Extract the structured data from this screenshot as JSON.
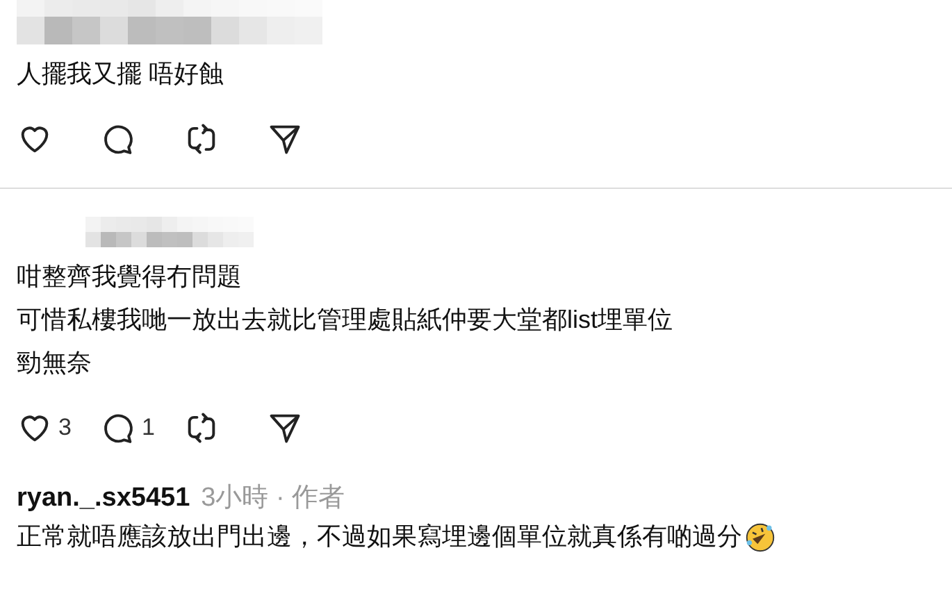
{
  "posts": [
    {
      "header": {
        "kind": "pixelated"
      },
      "lines": [
        "人擺我又擺 唔好蝕"
      ],
      "actions": [
        {
          "kind": "like"
        },
        {
          "kind": "reply"
        },
        {
          "kind": "repost"
        },
        {
          "kind": "share"
        }
      ]
    },
    {
      "header": {
        "kind": "pixelated"
      },
      "lines": [
        "咁整齊我覺得冇問題",
        "可惜私樓我哋一放出去就比管理處貼紙仲要大堂都list埋單位",
        "勁無奈"
      ],
      "actions": [
        {
          "kind": "like",
          "count": "3"
        },
        {
          "kind": "reply",
          "count": "1"
        },
        {
          "kind": "repost"
        },
        {
          "kind": "share"
        }
      ]
    },
    {
      "header": {
        "kind": "user",
        "username": "ryan._.sx5451",
        "meta": "3小時 · 作者"
      },
      "lines": [
        "正常就唔應該放出門出邊，不過如果寫埋邊個單位就真係有啲過分"
      ],
      "trailing_icon": {
        "kind": "laughing-face"
      }
    }
  ]
}
